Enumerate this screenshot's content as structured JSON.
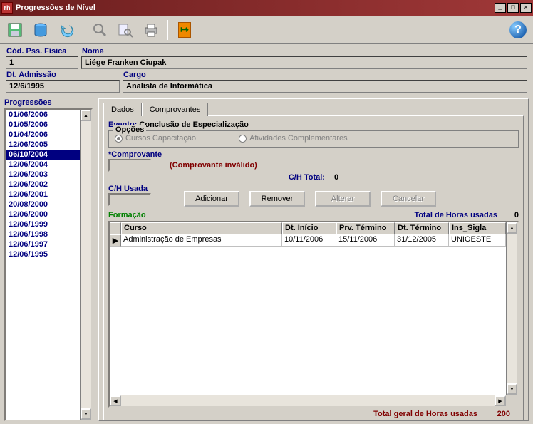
{
  "window": {
    "title": "Progressões de Nível"
  },
  "toolbar_icons": {
    "save": "save-icon",
    "db": "database-icon",
    "undo": "undo-icon",
    "search": "search-icon",
    "find": "find-icon",
    "print": "print-icon",
    "exit": "exit-icon",
    "help": "help-icon"
  },
  "header": {
    "cod_label": "Cód. Pss. Física",
    "cod_value": "1",
    "nome_label": "Nome",
    "nome_value": "Liége Franken Ciupak",
    "admissao_label": "Dt. Admissão",
    "admissao_value": "12/6/1995",
    "cargo_label": "Cargo",
    "cargo_value": "Analista de Informática"
  },
  "progressoes": {
    "label": "Progressões",
    "selected_index": 4,
    "items": [
      "01/06/2006",
      "01/05/2006",
      "01/04/2006",
      "12/06/2005",
      "06/10/2004",
      "12/06/2004",
      "12/06/2003",
      "12/06/2002",
      "12/06/2001",
      "20/08/2000",
      "12/06/2000",
      "12/06/1999",
      "12/06/1998",
      "12/06/1997",
      "12/06/1995"
    ]
  },
  "tabs": {
    "dados": "Dados",
    "comprovantes": "Comprovantes",
    "active": "comprovantes"
  },
  "detail": {
    "evento_label": "Evento:",
    "evento_value": "Conclusão de Especialização",
    "opcoes_label": "Opções",
    "radio_cursos": "Cursos Capacitação",
    "radio_atividades": "Atividades Complementares",
    "comprovante_label": "*Comprovante",
    "comprovante_invalid": "(Comprovante inválido)",
    "ch_total_label": "C/H Total:",
    "ch_total_value": "0",
    "ch_usada_label": "C/H Usada",
    "btn_adicionar": "Adicionar",
    "btn_remover": "Remover",
    "btn_alterar": "Alterar",
    "btn_cancelar": "Cancelar",
    "formacao_label": "Formação",
    "total_horas_label": "Total de Horas usadas",
    "total_horas_value": "0"
  },
  "grid": {
    "columns": [
      "Curso",
      "Dt. Início",
      "Prv. Término",
      "Dt. Término",
      "Ins_Sigla"
    ],
    "rows": [
      {
        "curso": "Administração de Empresas",
        "dt_inicio": "10/11/2006",
        "prv_termino": "15/11/2006",
        "dt_termino": "31/12/2005",
        "ins_sigla": "UNIOESTE"
      }
    ]
  },
  "footer": {
    "label": "Total geral de Horas usadas",
    "value": "200"
  }
}
